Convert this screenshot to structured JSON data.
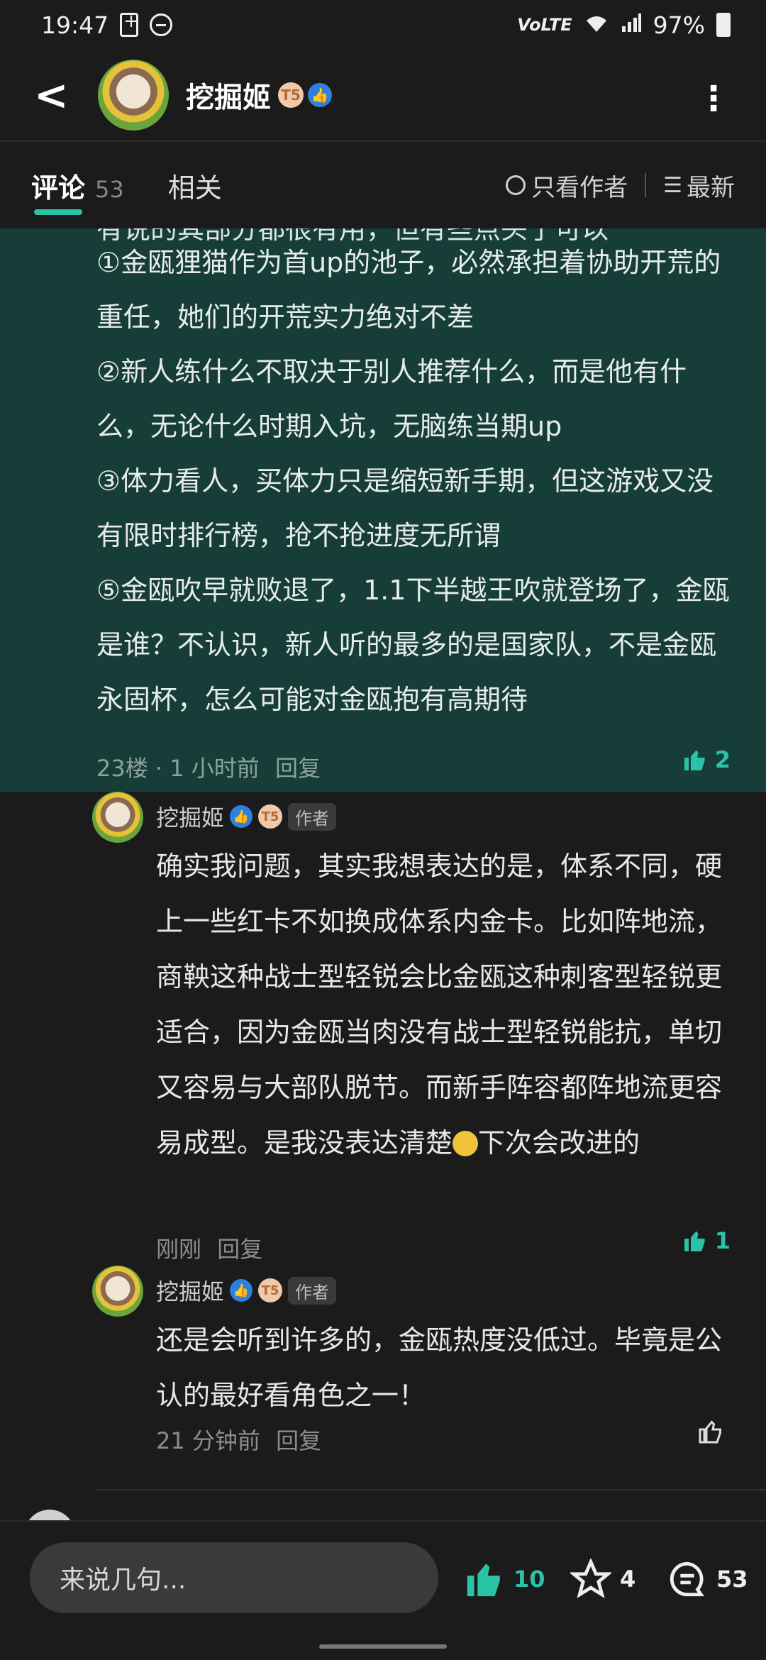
{
  "status_bar": {
    "time": "19:47",
    "network": "VoLTE",
    "signal": "4G",
    "battery": "97%"
  },
  "header": {
    "title": "挖掘姬",
    "level_badge": "T5",
    "back_icon": "back-arrow-icon",
    "more_icon": "more-vertical-icon"
  },
  "tabs": {
    "comments_label": "评论",
    "comments_count": "53",
    "related_label": "相关",
    "author_only_label": "只看作者",
    "sort_label": "最新"
  },
  "highlighted_comment": {
    "cut_line": "有说的其部分都很有用，但有些点头了可以",
    "paragraphs": [
      "①金瓯狸猫作为首up的池子，必然承担着协助开荒的重任，她们的开荒实力绝对不差",
      "②新人练什么不取决于别人推荐什么，而是他有什么，无论什么时期入坑，无脑练当期up",
      "③体力看人，买体力只是缩短新手期，但这游戏又没有限时排行榜，抢不抢进度无所谓",
      "⑤金瓯吹早就败退了，1.1下半越王吹就登场了，金瓯是谁？不认识，新人听的最多的是国家队，不是金瓯永固杯，怎么可能对金瓯抱有高期待"
    ],
    "floor": "23楼",
    "dot": "·",
    "time": "1 小时前",
    "reply_label": "回复",
    "likes": "2"
  },
  "replies": [
    {
      "name": "挖掘姬",
      "level_badge": "T5",
      "author_tag": "作者",
      "text_before_emoji": "确实我问题，其实我想表达的是，体系不同，硬上一些红卡不如换成体系内金卡。比如阵地流，商鞅这种战士型轻锐会比金瓯这种刺客型轻锐更适合，因为金瓯当肉没有战士型轻锐能抗，单切又容易与大部队脱节。而新手阵容都阵地流更容易成型。是我没表达清楚",
      "text_after_emoji": "下次会改进的",
      "time": "刚刚",
      "reply_label": "回复",
      "likes": "1"
    },
    {
      "name": "挖掘姬",
      "level_badge": "T5",
      "author_tag": "作者",
      "text": "还是会听到许多的，金瓯热度没低过。毕竟是公认的最好看角色之一！",
      "time": "21 分钟前",
      "reply_label": "回复",
      "likes": ""
    }
  ],
  "bottom_bar": {
    "input_placeholder": "来说几句...",
    "like_count": "10",
    "star_count": "4",
    "comment_count": "53"
  },
  "colors": {
    "accent": "#2bc3a8",
    "highlight_bg": "#173d39",
    "background": "#1b1b1b"
  }
}
